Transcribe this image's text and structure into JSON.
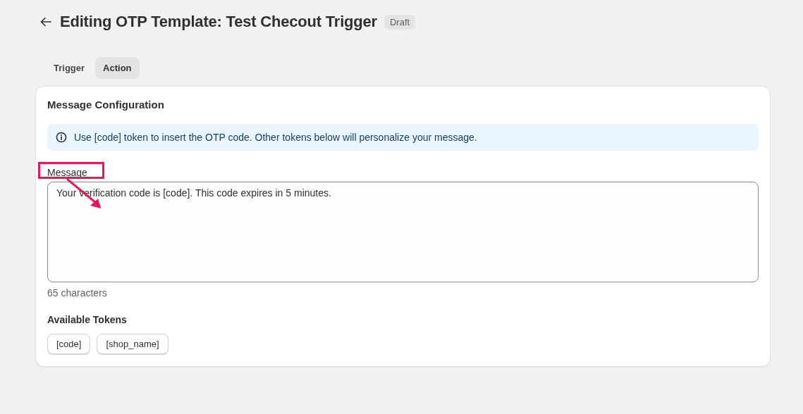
{
  "header": {
    "title": "Editing OTP Template: Test Checout Trigger",
    "badge": "Draft"
  },
  "tabs": [
    {
      "label": "Trigger",
      "selected": false
    },
    {
      "label": "Action",
      "selected": true
    }
  ],
  "card": {
    "title": "Message Configuration",
    "info": "Use [code] token to insert the OTP code. Other tokens below will personalize your message.",
    "message_label": "Message",
    "message_value": "Your verification code is [code]. This code expires in 5 minutes.",
    "char_count": "65 characters",
    "tokens_title": "Available Tokens",
    "tokens": [
      "[code]",
      "[shop_name]"
    ]
  }
}
